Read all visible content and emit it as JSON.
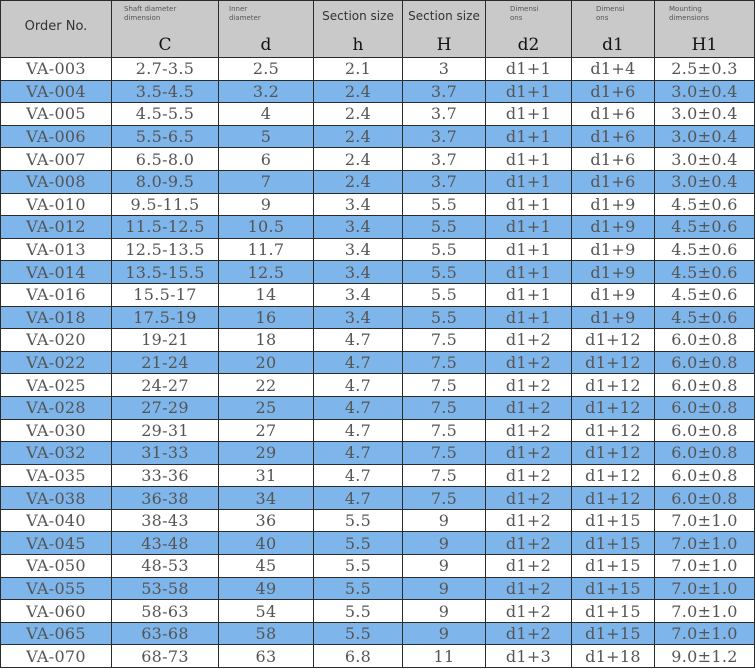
{
  "headers": {
    "order": {
      "top": "Order No.",
      "bottom": ""
    },
    "c": {
      "top": "Shaft diameter dimension",
      "bottom": "C"
    },
    "d": {
      "top": "Inner diameter",
      "bottom": "d"
    },
    "h": {
      "top": "Section size",
      "bottom": "h"
    },
    "H": {
      "top": "Section size",
      "bottom": "H"
    },
    "d2": {
      "top": "Dimensi ons",
      "bottom": "d2"
    },
    "d1": {
      "top": "Dimensi ons",
      "bottom": "d1"
    },
    "H1": {
      "top": "Mounting dimensions",
      "bottom": "H1"
    }
  },
  "rows": [
    [
      "VA-003",
      "2.7-3.5",
      "2.5",
      "2.1",
      "3",
      "d1+1",
      "d1+4",
      "2.5±0.3"
    ],
    [
      "VA-004",
      "3.5-4.5",
      "3.2",
      "2.4",
      "3.7",
      "d1+1",
      "d1+6",
      "3.0±0.4"
    ],
    [
      "VA-005",
      "4.5-5.5",
      "4",
      "2.4",
      "3.7",
      "d1+1",
      "d1+6",
      "3.0±0.4"
    ],
    [
      "VA-006",
      "5.5-6.5",
      "5",
      "2.4",
      "3.7",
      "d1+1",
      "d1+6",
      "3.0±0.4"
    ],
    [
      "VA-007",
      "6.5-8.0",
      "6",
      "2.4",
      "3.7",
      "d1+1",
      "d1+6",
      "3.0±0.4"
    ],
    [
      "VA-008",
      "8.0-9.5",
      "7",
      "2.4",
      "3.7",
      "d1+1",
      "d1+6",
      "3.0±0.4"
    ],
    [
      "VA-010",
      "9.5-11.5",
      "9",
      "3.4",
      "5.5",
      "d1+1",
      "d1+9",
      "4.5±0.6"
    ],
    [
      "VA-012",
      "11.5-12.5",
      "10.5",
      "3.4",
      "5.5",
      "d1+1",
      "d1+9",
      "4.5±0.6"
    ],
    [
      "VA-013",
      "12.5-13.5",
      "11.7",
      "3.4",
      "5.5",
      "d1+1",
      "d1+9",
      "4.5±0.6"
    ],
    [
      "VA-014",
      "13.5-15.5",
      "12.5",
      "3.4",
      "5.5",
      "d1+1",
      "d1+9",
      "4.5±0.6"
    ],
    [
      "VA-016",
      "15.5-17",
      "14",
      "3.4",
      "5.5",
      "d1+1",
      "d1+9",
      "4.5±0.6"
    ],
    [
      "VA-018",
      "17.5-19",
      "16",
      "3.4",
      "5.5",
      "d1+1",
      "d1+9",
      "4.5±0.6"
    ],
    [
      "VA-020",
      "19-21",
      "18",
      "4.7",
      "7.5",
      "d1+2",
      "d1+12",
      "6.0±0.8"
    ],
    [
      "VA-022",
      "21-24",
      "20",
      "4.7",
      "7.5",
      "d1+2",
      "d1+12",
      "6.0±0.8"
    ],
    [
      "VA-025",
      "24-27",
      "22",
      "4.7",
      "7.5",
      "d1+2",
      "d1+12",
      "6.0±0.8"
    ],
    [
      "VA-028",
      "27-29",
      "25",
      "4.7",
      "7.5",
      "d1+2",
      "d1+12",
      "6.0±0.8"
    ],
    [
      "VA-030",
      "29-31",
      "27",
      "4.7",
      "7.5",
      "d1+2",
      "d1+12",
      "6.0±0.8"
    ],
    [
      "VA-032",
      "31-33",
      "29",
      "4.7",
      "7.5",
      "d1+2",
      "d1+12",
      "6.0±0.8"
    ],
    [
      "VA-035",
      "33-36",
      "31",
      "4.7",
      "7.5",
      "d1+2",
      "d1+12",
      "6.0±0.8"
    ],
    [
      "VA-038",
      "36-38",
      "34",
      "4.7",
      "7.5",
      "d1+2",
      "d1+12",
      "6.0±0.8"
    ],
    [
      "VA-040",
      "38-43",
      "36",
      "5.5",
      "9",
      "d1+2",
      "d1+15",
      "7.0±1.0"
    ],
    [
      "VA-045",
      "43-48",
      "40",
      "5.5",
      "9",
      "d1+2",
      "d1+15",
      "7.0±1.0"
    ],
    [
      "VA-050",
      "48-53",
      "45",
      "5.5",
      "9",
      "d1+2",
      "d1+15",
      "7.0±1.0"
    ],
    [
      "VA-055",
      "53-58",
      "49",
      "5.5",
      "9",
      "d1+2",
      "d1+15",
      "7.0±1.0"
    ],
    [
      "VA-060",
      "58-63",
      "54",
      "5.5",
      "9",
      "d1+2",
      "d1+15",
      "7.0±1.0"
    ],
    [
      "VA-065",
      "63-68",
      "58",
      "5.5",
      "9",
      "d1+2",
      "d1+15",
      "7.0±1.0"
    ],
    [
      "VA-070",
      "68-73",
      "63",
      "6.8",
      "11",
      "d1+3",
      "d1+18",
      "9.0±1.2"
    ]
  ],
  "colors": {
    "header_bg": "#c9c9c9",
    "stripe": "#7eb5ea",
    "text": "#555555",
    "border": "#2b2b2b"
  }
}
